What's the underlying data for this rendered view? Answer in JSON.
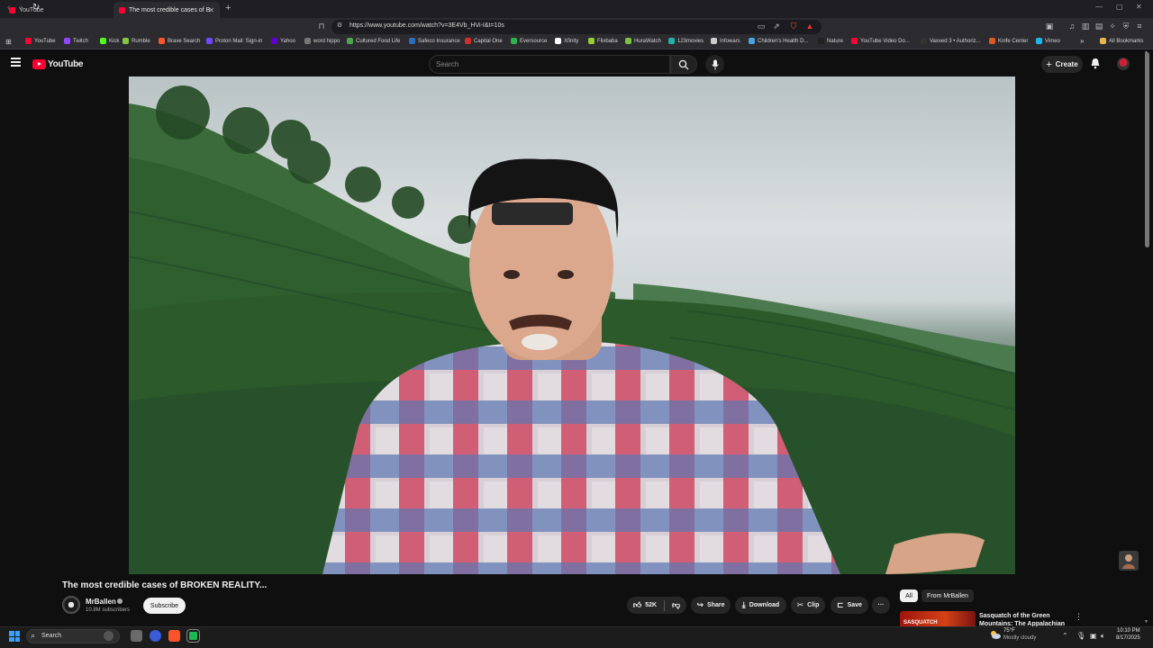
{
  "browser": {
    "tabs": [
      {
        "label": "YouTube",
        "active": false
      },
      {
        "label": "The most credible cases of B",
        "active": true
      }
    ],
    "new_tab": "+",
    "url": "https://www.youtube.com/watch?v=3E4Vb_HVi-I&t=10s",
    "bookmarks": [
      {
        "label": "YouTube",
        "color": "#ff0033"
      },
      {
        "label": "Twitch",
        "color": "#9146ff"
      },
      {
        "label": "Kick",
        "color": "#53fc18"
      },
      {
        "label": "Rumble",
        "color": "#85c742"
      },
      {
        "label": "Brave Search",
        "color": "#fb542b"
      },
      {
        "label": "Proton Mail: Sign-in",
        "color": "#6d4aff"
      },
      {
        "label": "Yahoo",
        "color": "#6001d2"
      },
      {
        "label": "word hippo",
        "color": "#777777"
      },
      {
        "label": "Cultured Food Life",
        "color": "#4ca64c"
      },
      {
        "label": "Safeco Insurance",
        "color": "#2a6ebb"
      },
      {
        "label": "Capital One",
        "color": "#d03027"
      },
      {
        "label": "Eversource",
        "color": "#2bb24c"
      },
      {
        "label": "Xfinity",
        "color": "#ffffff"
      },
      {
        "label": "Flixbaba",
        "color": "#9acd32"
      },
      {
        "label": "HuraWatch",
        "color": "#7cc242"
      },
      {
        "label": "123movies",
        "color": "#20b2aa"
      },
      {
        "label": "Infowars",
        "color": "#cccccc"
      },
      {
        "label": "Children's Health D...",
        "color": "#4aa3df"
      },
      {
        "label": "Nature",
        "color": "#222222"
      },
      {
        "label": "YouTube Video Do...",
        "color": "#ff0033"
      },
      {
        "label": "Vaxxed 3 • Authoriz...",
        "color": "#333333"
      },
      {
        "label": "Knife Center",
        "color": "#e05a1f"
      },
      {
        "label": "Vimeo",
        "color": "#1ab7ea"
      }
    ],
    "more_bookmarks": "»",
    "all_bookmarks": "All Bookmarks"
  },
  "youtube": {
    "logo_text": "YouTube",
    "search_placeholder": "Search",
    "create_label": "Create",
    "video_title": "The most credible cases of BROKEN REALITY...",
    "channel_name": "MrBallen",
    "subscribers": "10.8M subscribers",
    "subscribe_label": "Subscribe",
    "like_count": "52K",
    "share_label": "Share",
    "download_label": "Download",
    "clip_label": "Clip",
    "save_label": "Save",
    "more_label": "···",
    "chips": {
      "all": "All",
      "from_channel": "From MrBallen"
    },
    "recommended": {
      "title": "Sasquatch of the Green Mountains: The Appalachian",
      "thumb_text": "SASQUATCH"
    }
  },
  "taskbar": {
    "search_label": "Search",
    "weather_temp": "75°F",
    "weather_desc": "Mostly cloudy",
    "time": "10:10 PM",
    "date": "8/17/2025"
  },
  "colors": {
    "accent": "#ff0033",
    "background": "#0f0f0f",
    "pill": "#272727"
  }
}
